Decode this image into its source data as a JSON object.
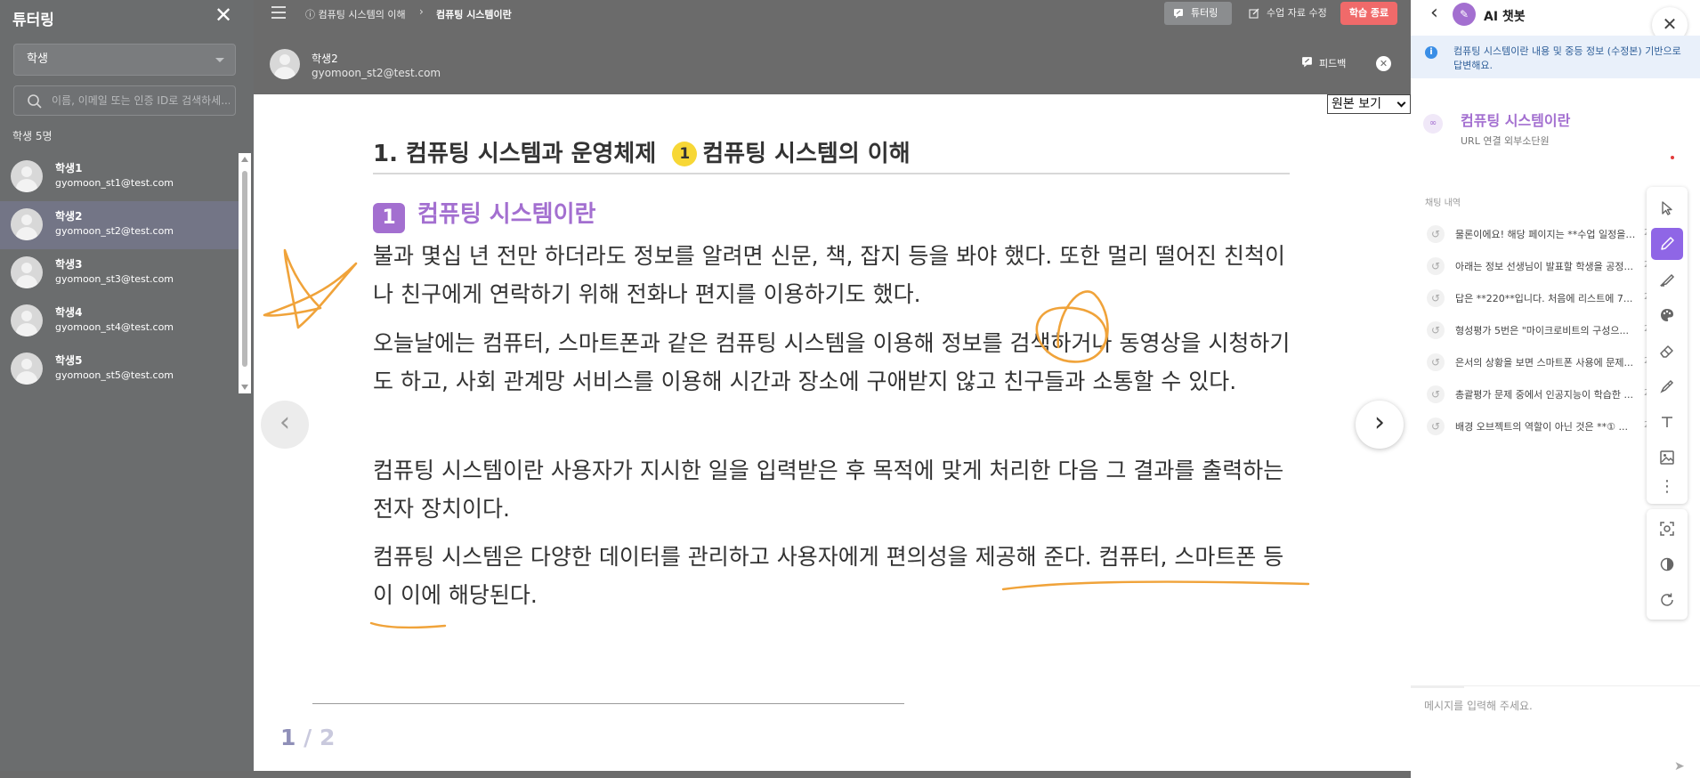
{
  "sidebar": {
    "title": "튜터링",
    "select_value": "학생",
    "search_placeholder": "이름, 이메일 또는 인증 ID로 검색하세...",
    "count_label": "학생 5명",
    "students": [
      {
        "name": "학생1",
        "email": "gyomoon_st1@test.com"
      },
      {
        "name": "학생2",
        "email": "gyomoon_st2@test.com"
      },
      {
        "name": "학생3",
        "email": "gyomoon_st3@test.com"
      },
      {
        "name": "학생4",
        "email": "gyomoon_st4@test.com"
      },
      {
        "name": "학생5",
        "email": "gyomoon_st5@test.com"
      }
    ],
    "active_index": 1
  },
  "topbar": {
    "breadcrumb_parent": "컴퓨팅 시스템의 이해",
    "breadcrumb_current": "컴퓨팅 시스템이란",
    "tutoring_label": "튜터링",
    "edit_label": "수업 자료 수정",
    "end_label": "학습 종료"
  },
  "student_header": {
    "name": "학생2",
    "email": "gyomoon_st2@test.com",
    "feedback_label": "피드백"
  },
  "document": {
    "view_select": "원본 보기",
    "chapter_title": "1. 컴퓨팅 시스템과 운영체제",
    "section_number": "1",
    "section_title": "컴퓨팅 시스템의 이해",
    "topic_number": "1",
    "topic_title": "컴퓨팅 시스템이란",
    "paragraphs": [
      "불과 몇십 년 전만 하더라도 정보를 알려면 신문, 책, 잡지 등을 봐야 했다. 또한 멀리 떨어진 친척이나 친구에게 연락하기 위해 전화나 편지를 이용하기도 했다.",
      "오늘날에는 컴퓨터, 스마트폰과 같은 컴퓨팅 시스템을 이용해 정보를 검색하거나 동영상을 시청하기도 하고, 사회 관계망 서비스를 이용해 시간과 장소에 구애받지 않고 친구들과 소통할 수 있다.",
      "컴퓨팅 시스템이란 사용자가 지시한 일을 입력받은 후 목적에 맞게 처리한 다음 그 결과를 출력하는 전자 장치이다.",
      "컴퓨팅 시스템은 다양한 데이터를 관리하고 사용자에게 편의성을 제공해 준다. 컴퓨터, 스마트폰 등이 이에 해당된다."
    ],
    "page_current": "1",
    "page_separator": "/",
    "page_total": "2",
    "annotation_color": "#f0a33a"
  },
  "chat": {
    "title": "AI 챗봇",
    "notice": "컴퓨팅 시스템이란 내용 및 중등 정보 (수정본) 기반으로 답변해요.",
    "source_title": "컴퓨팅 시스템이란",
    "source_subtitle": "URL 연결 외부소단원",
    "history_label": "채팅 내역",
    "history": [
      {
        "text": "물론이에요! 해당 페이지는 **수업 일정을 만드...",
        "num": "2"
      },
      {
        "text": "아래는 정보 선생님이 발표할 학생을 공정...",
        "num": "2"
      },
      {
        "text": "답은 **220**입니다. 처음에 리스트에 7...",
        "num": "2"
      },
      {
        "text": "형성평가 5번은 \"마이크로비트의 구성으...",
        "num": "2"
      },
      {
        "text": "은서의 상황을 보면 스마트폰 사용에 문제...",
        "num": "2"
      },
      {
        "text": "총괄평가 문제 중에서 인공지능이 학습한 ...",
        "num": "2"
      },
      {
        "text": "배경 오브젝트의 역할이 아닌 것은 **① ...",
        "num": "2"
      }
    ],
    "input_placeholder": "메시지를 입력해 주세요.",
    "accent_color": "#a36fd0"
  }
}
